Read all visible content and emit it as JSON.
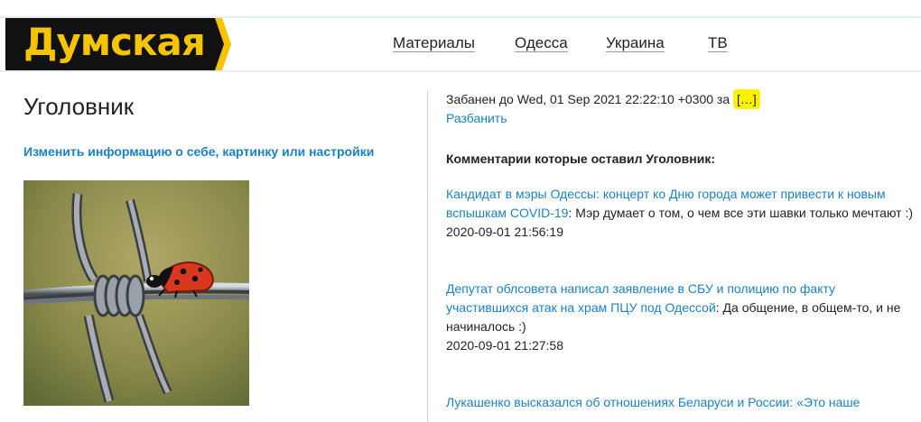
{
  "header": {
    "logo_text": "Думская",
    "logo_bg": "#111111",
    "logo_color": "#f5c400",
    "nav": [
      "Материалы",
      "Одесса",
      "Украина",
      "ТВ"
    ]
  },
  "profile": {
    "name": "Уголовник",
    "settings_link": "Изменить информацию о себе, картинку или настройки"
  },
  "ban": {
    "prefix": "Забанен до Wed, 01 Sep 2021 22:22:10 +0300 за",
    "reason": "[…]",
    "unban_label": "Разбанить"
  },
  "comments": {
    "title": "Комментарии которые оставил Уголовник:",
    "items": [
      {
        "article": "Кандидат в мэры Одессы: концерт ко Дню города может привести к новым вспышкам COVID-19",
        "text": ": Мэр думает о том, о чем все эти шавки только мечтают :)",
        "date": "2020-09-01 21:56:19"
      },
      {
        "article": "Депутат облсовета написал заявление в СБУ и полицию по факту участившихся атак на храм ПЦУ под Одессой",
        "text": ": Да общение, в общем-то, и не начиналось :)",
        "date": "2020-09-01 21:27:58"
      },
      {
        "article": "Лукашенко высказался об отношениях Беларуси и России: «Это наше",
        "text": "",
        "date": ""
      }
    ]
  },
  "colors": {
    "link": "#1a82c4",
    "highlight": "#fff200"
  }
}
